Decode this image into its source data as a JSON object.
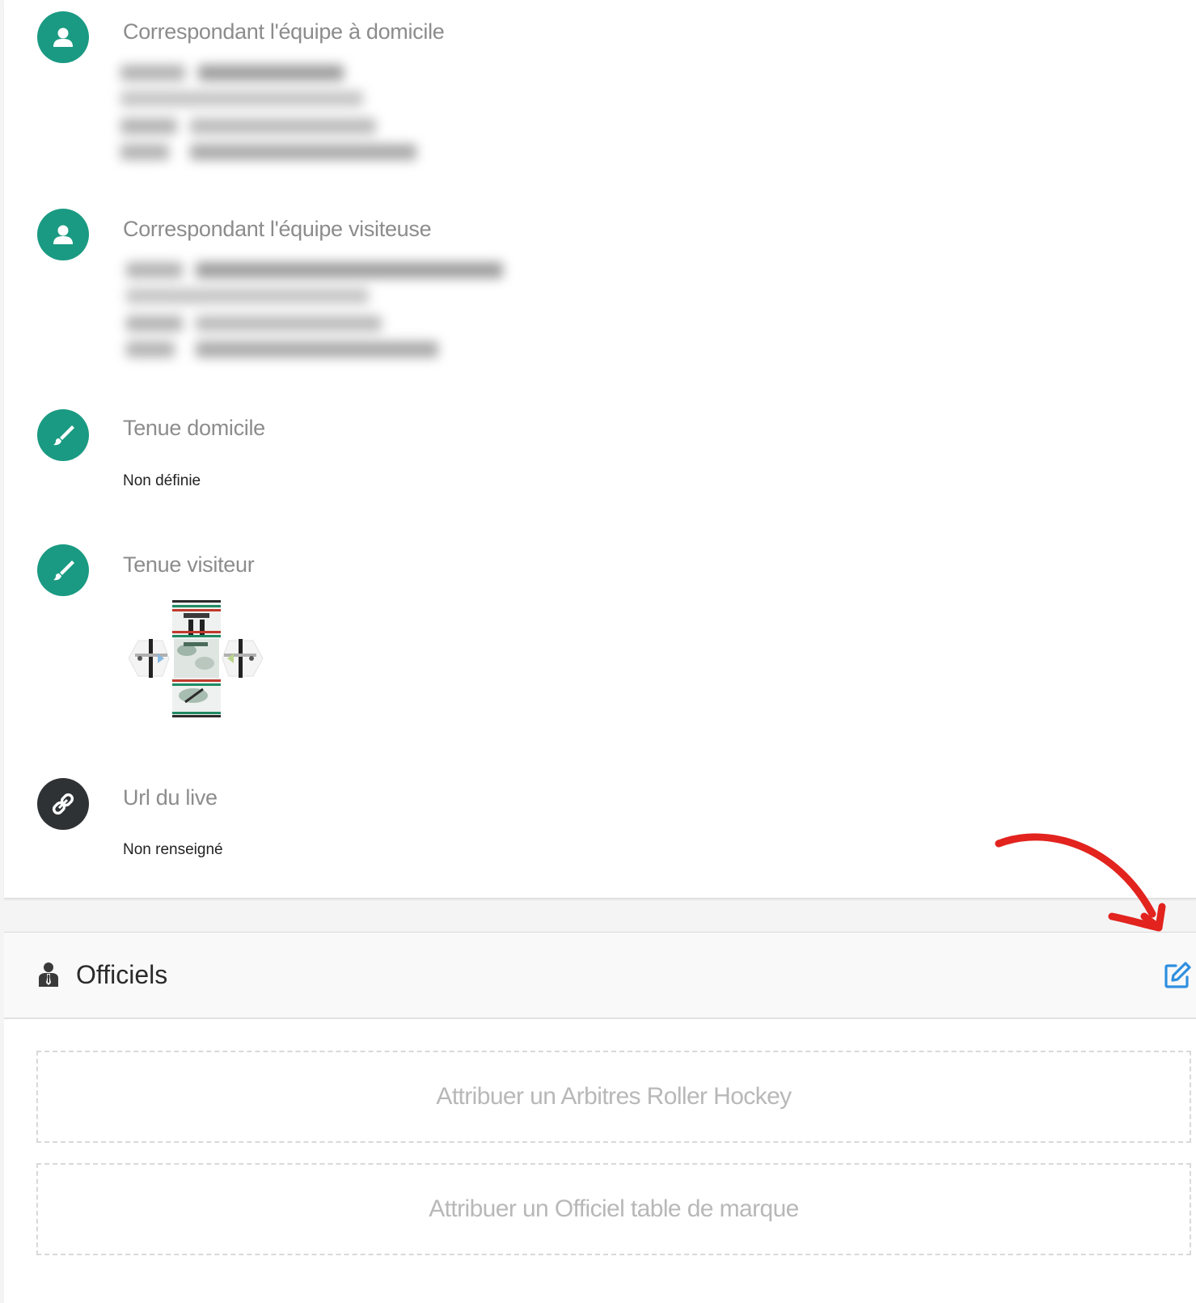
{
  "details": {
    "home_contact": {
      "title": "Correspondant l'équipe à domicile",
      "icon": "user-icon"
    },
    "away_contact": {
      "title": "Correspondant l'équipe visiteuse",
      "icon": "user-icon"
    },
    "home_kit": {
      "title": "Tenue domicile",
      "value": "Non définie",
      "icon": "brush-icon"
    },
    "away_kit": {
      "title": "Tenue visiteur",
      "icon": "brush-icon"
    },
    "live_url": {
      "title": "Url du live",
      "value": "Non renseigné",
      "icon": "link-icon"
    }
  },
  "officials": {
    "title": "Officiels",
    "icon": "officials-icon",
    "edit_icon": "edit-icon",
    "assign_referee": "Attribuer un Arbitres Roller Hockey",
    "assign_table": "Attribuer un Officiel table de marque"
  },
  "colors": {
    "accent": "#1a9a82",
    "dark_icon": "#2f3235",
    "edit": "#2f8fe0",
    "annotation_arrow": "#e2231e"
  }
}
